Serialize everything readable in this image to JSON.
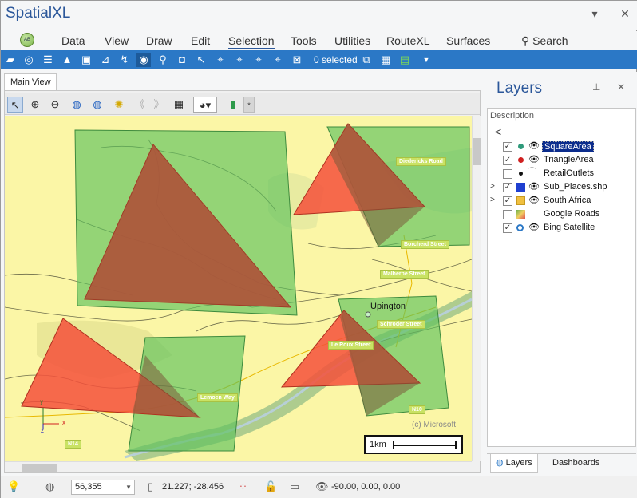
{
  "app": {
    "title": "SpatialXL"
  },
  "menu": {
    "items": [
      "Data",
      "View",
      "Draw",
      "Edit",
      "Selection",
      "Tools",
      "Utilities",
      "RouteXL",
      "Surfaces"
    ],
    "active": "Selection",
    "search_label": "Search"
  },
  "toolbar": {
    "selected_text": "0 selected"
  },
  "map_view": {
    "tab_label": "Main View",
    "road_labels": [
      "Diedericks Road",
      "Borcherd Street",
      "Malherbe Street",
      "Schroder Street",
      "Le Roux Street",
      "Lemoen Way",
      "N10",
      "N14"
    ],
    "city_label": "Upington",
    "copyright": "(c) Microsoft",
    "scale_label": "1km",
    "axis_y": "y",
    "axis_x": "x",
    "axis_z": "z"
  },
  "layers_panel": {
    "title": "Layers",
    "column_header": "Description",
    "back_glyph": "<",
    "layers": [
      {
        "name": "SquareArea",
        "checked": true,
        "visible": true,
        "selected": true,
        "expandable": false,
        "symbol": "teal-dot"
      },
      {
        "name": "TriangleArea",
        "checked": true,
        "visible": true,
        "selected": false,
        "expandable": false,
        "symbol": "red-dot"
      },
      {
        "name": "RetailOutlets",
        "checked": false,
        "visible": false,
        "selected": false,
        "expandable": false,
        "symbol": "black-dot"
      },
      {
        "name": "Sub_Places.shp",
        "checked": true,
        "visible": true,
        "selected": false,
        "expandable": true,
        "symbol": "blue-polygon"
      },
      {
        "name": "South Africa",
        "checked": true,
        "visible": true,
        "selected": false,
        "expandable": true,
        "symbol": "folder"
      },
      {
        "name": "Google Roads",
        "checked": false,
        "visible": false,
        "selected": false,
        "expandable": false,
        "symbol": "map-tile"
      },
      {
        "name": "Bing Satellite",
        "checked": true,
        "visible": true,
        "selected": false,
        "expandable": false,
        "symbol": "satellite"
      }
    ],
    "tabs": [
      "Layers",
      "Dashboards"
    ],
    "active_tab": "Layers"
  },
  "status": {
    "scale_value": "56,355",
    "coordinates": "21.227; -28.456",
    "view_angles": "-90.00, 0.00, 0.00"
  },
  "colors": {
    "accent": "#2b579a",
    "toolbar": "#2b78c6",
    "map_background": "#fbf6a6",
    "square_fill": "#5cc25c",
    "triangle_fill": "#f4503b",
    "selection": "#0b2c8c"
  }
}
